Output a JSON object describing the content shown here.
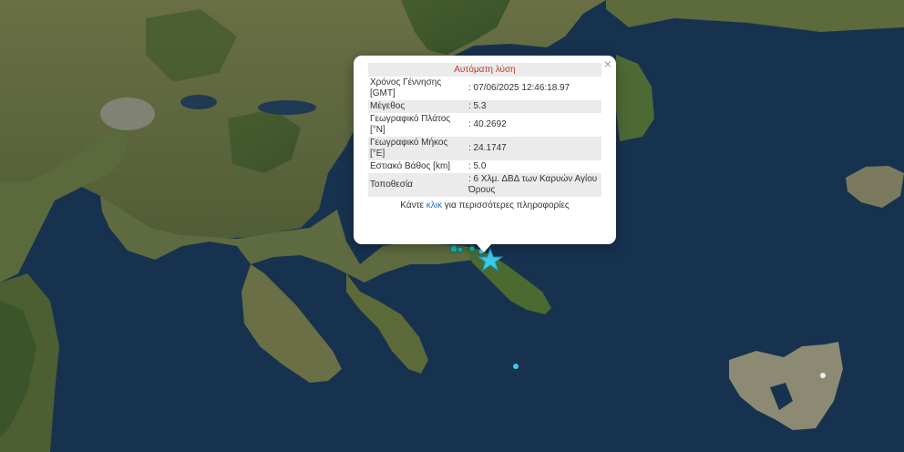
{
  "popup": {
    "title": "Αυτόματη λύση",
    "close_glyph": "×",
    "rows": [
      {
        "label": "Χρόνος Γέννησης [GMT]",
        "value": ": 07/06/2025 12:46:18.97"
      },
      {
        "label": "Μέγεθος",
        "value": ": 5.3"
      },
      {
        "label": "Γεωγραφικό Πλάτος [°N]",
        "value": ": 40.2692"
      },
      {
        "label": "Γεωγραφικό Μήκος [°E]",
        "value": ": 24.1747"
      },
      {
        "label": "Εστιακό Βάθος [km]",
        "value": ": 5.0"
      },
      {
        "label": "Τοποθεσία",
        "value": ": 6 Χλμ. ΔΒΔ των Καρυών Αγίου Όρους"
      }
    ],
    "footer_prefix": "Κάντε ",
    "footer_link": "κλικ",
    "footer_suffix": " για περισσότερες πληροφορίες"
  },
  "map": {
    "sea_color": "#17324f",
    "land_color": "#5c6a3f",
    "epicenter_icon": "star-icon",
    "epicenter_color": "#3fc6e8",
    "aftershock_color": "#20b8a8"
  }
}
